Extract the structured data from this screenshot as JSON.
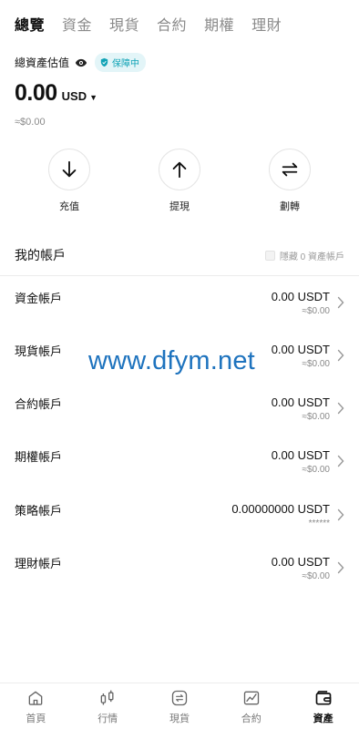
{
  "top_tabs": [
    {
      "label": "總覽",
      "active": true
    },
    {
      "label": "資金",
      "active": false
    },
    {
      "label": "現貨",
      "active": false
    },
    {
      "label": "合約",
      "active": false
    },
    {
      "label": "期權",
      "active": false
    },
    {
      "label": "理財",
      "active": false
    }
  ],
  "overview": {
    "title": "總資產估值",
    "protect_badge": "保障中",
    "balance": "0.00",
    "currency": "USD",
    "approx": "≈$0.00"
  },
  "actions": [
    {
      "label": "充值",
      "icon": "arrow-down-icon"
    },
    {
      "label": "提現",
      "icon": "arrow-up-icon"
    },
    {
      "label": "劃轉",
      "icon": "transfer-icon"
    }
  ],
  "accounts_section": {
    "title": "我的帳戶",
    "hide_zero_label": "隱藏 0 資產帳戶"
  },
  "accounts": [
    {
      "name": "資金帳戶",
      "amount": "0.00 USDT",
      "sub": "≈$0.00"
    },
    {
      "name": "現貨帳戶",
      "amount": "0.00 USDT",
      "sub": "≈$0.00"
    },
    {
      "name": "合約帳戶",
      "amount": "0.00 USDT",
      "sub": "≈$0.00"
    },
    {
      "name": "期權帳戶",
      "amount": "0.00 USDT",
      "sub": "≈$0.00"
    },
    {
      "name": "策略帳戶",
      "amount": "0.00000000 USDT",
      "sub": "******"
    },
    {
      "name": "理財帳戶",
      "amount": "0.00 USDT",
      "sub": "≈$0.00"
    }
  ],
  "watermark": "www.dfym.net",
  "bottom_nav": [
    {
      "label": "首頁",
      "icon": "home-icon",
      "active": false
    },
    {
      "label": "行情",
      "icon": "candlestick-icon",
      "active": false
    },
    {
      "label": "現貨",
      "icon": "exchange-icon",
      "active": false
    },
    {
      "label": "合約",
      "icon": "contract-chart-icon",
      "active": false
    },
    {
      "label": "資產",
      "icon": "wallet-icon",
      "active": true
    }
  ]
}
